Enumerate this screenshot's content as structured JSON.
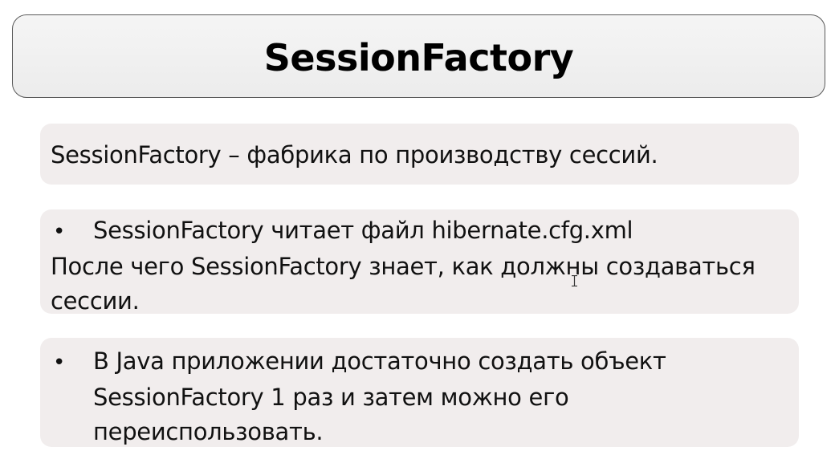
{
  "title": "SessionFactory",
  "blocks": [
    {
      "lines": [
        "SessionFactory – фабрика по производству сессий."
      ]
    },
    {
      "bullet": "•",
      "bullet_line": "SessionFactory читает файл hibernate.cfg.xml",
      "lines": [
        "После чего SessionFactory знает, как должны создаваться",
        "сессии."
      ]
    },
    {
      "bullet": "•",
      "bullet_line": "В Java приложении достаточно создать объект",
      "lines": [
        "SessionFactory 1 раз и затем можно его",
        "переиспользовать."
      ]
    }
  ],
  "colors": {
    "title_box_bg": "#eeeeee",
    "title_box_border": "#5a5a5a",
    "card_bg": "#f1eded",
    "text": "#111111"
  },
  "icons": {
    "cursor": "i-beam-cursor-icon"
  }
}
